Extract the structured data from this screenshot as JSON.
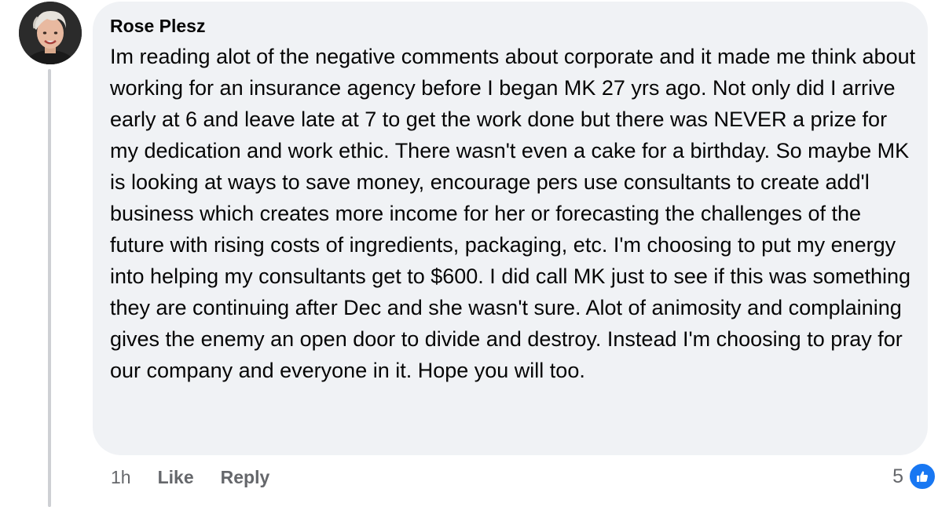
{
  "comment": {
    "author": "Rose Plesz",
    "text": "Im reading alot of the negative comments about corporate and it made me think about working for an insurance agency before I began MK 27 yrs ago. Not only did I arrive early at 6 and leave late at 7 to get the work done but there was NEVER a prize for my dedication and work ethic. There wasn't even a cake for a birthday. So maybe MK is looking at ways to save money, encourage pers use consultants to create add'l business which creates more income for her or forecasting the challenges of the future with rising costs of ingredients, packaging, etc. I'm choosing to put my energy into helping my consultants get to $600. I did call MK just to see if this was something they are continuing after Dec and she wasn't sure. Alot of animosity and complaining gives the enemy an open door to divide and destroy. Instead I'm choosing to pray for our company and everyone in it. Hope you will too.",
    "timestamp": "1h",
    "like_label": "Like",
    "reply_label": "Reply",
    "reaction_count": "5",
    "reaction_icon": "thumbs-up-icon",
    "accent_color": "#1877f2",
    "bubble_color": "#f0f2f5"
  }
}
